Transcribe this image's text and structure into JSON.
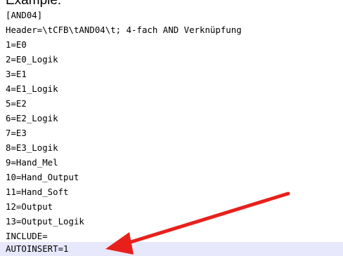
{
  "heading": "Example:",
  "editor": {
    "lines": [
      "[AND04]",
      "Header=\\tCFB\\tAND04\\t; 4-fach AND Verknüpfung",
      "1=E0",
      "2=E0_Logik",
      "3=E1",
      "4=E1_Logik",
      "5=E2",
      "6=E2_Logik",
      "7=E3",
      "8=E3_Logik",
      "9=Hand_Mel",
      "10=Hand_Output",
      "11=Hand_Soft",
      "12=Output",
      "13=Output_Logik",
      "INCLUDE=",
      "AUTOINSERT=1"
    ],
    "highlighted_line": "AUTOINSERT=1"
  },
  "colors": {
    "highlight": "#e8e8fc",
    "arrow": "#e8201c",
    "text": "#000000"
  }
}
